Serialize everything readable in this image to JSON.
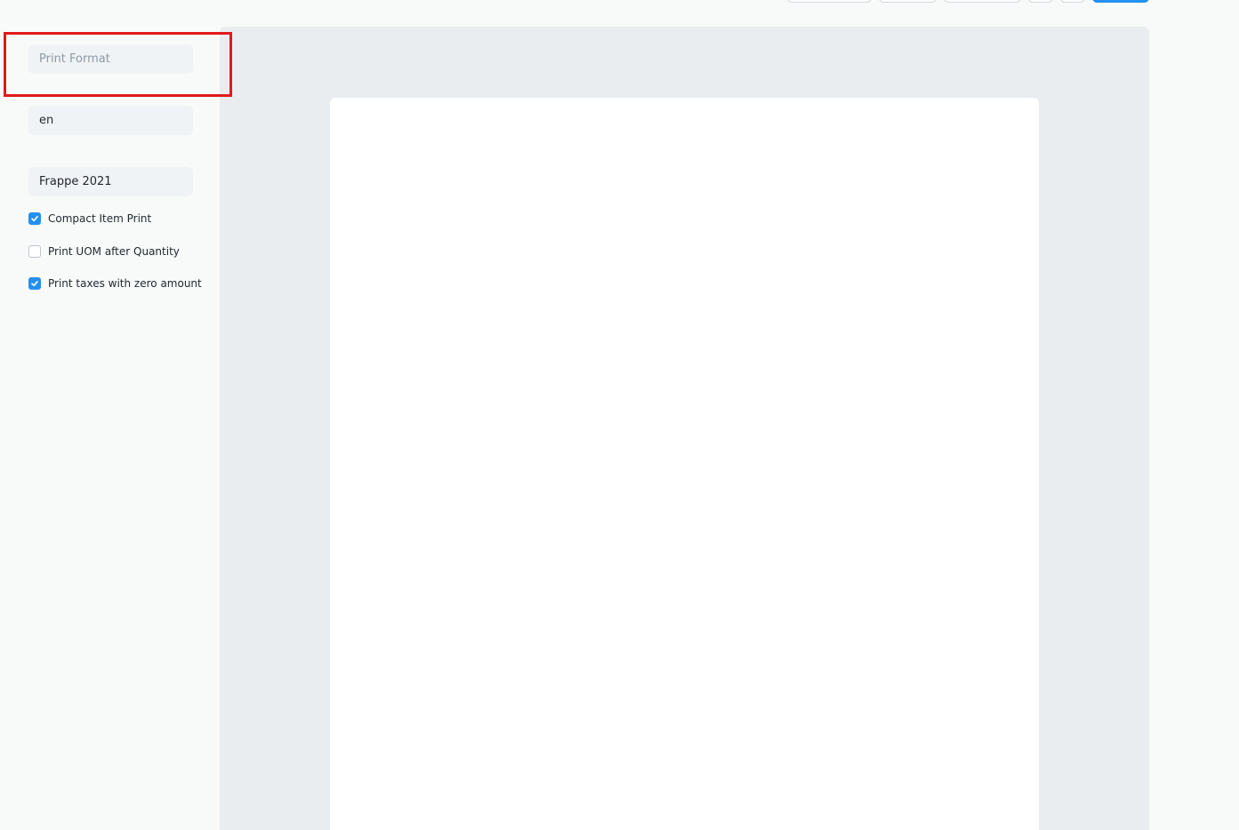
{
  "sidebar": {
    "print_format": {
      "value": "",
      "placeholder": "Print Format"
    },
    "language": {
      "value": "en"
    },
    "letterhead": {
      "value": "Frappe 2021"
    },
    "options": [
      {
        "label": "Compact Item Print",
        "checked": true
      },
      {
        "label": "Print UOM after Quantity",
        "checked": false
      },
      {
        "label": "Print taxes with zero amount",
        "checked": true
      }
    ]
  },
  "colors": {
    "accent": "#2490ef",
    "highlight": "#e01b1b",
    "preview_bg": "#e9edf0"
  }
}
